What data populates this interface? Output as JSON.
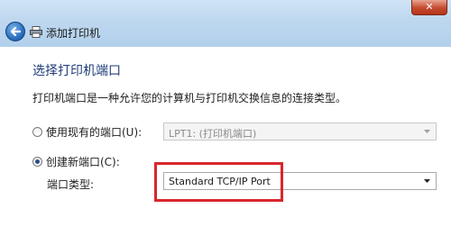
{
  "window": {
    "title": "添加打印机",
    "close_glyph": "✕"
  },
  "page": {
    "heading": "选择打印机端口",
    "description": "打印机端口是一种允许您的计算机与打印机交换信息的连接类型。"
  },
  "existing_port": {
    "label": "使用现有的端口(U):",
    "selected": false,
    "value": "LPT1: (打印机端口)",
    "enabled": false
  },
  "new_port": {
    "label": "创建新端口(C):",
    "selected": true,
    "type_label": "端口类型:",
    "value": "Standard TCP/IP Port"
  },
  "icons": {
    "back": "arrow-left",
    "printer": "printer",
    "close": "x"
  },
  "colors": {
    "titlebar": "#bdd7ef",
    "heading": "#1f3d7a",
    "highlight_box": "#d9262c",
    "close_button": "#c44a2e"
  }
}
